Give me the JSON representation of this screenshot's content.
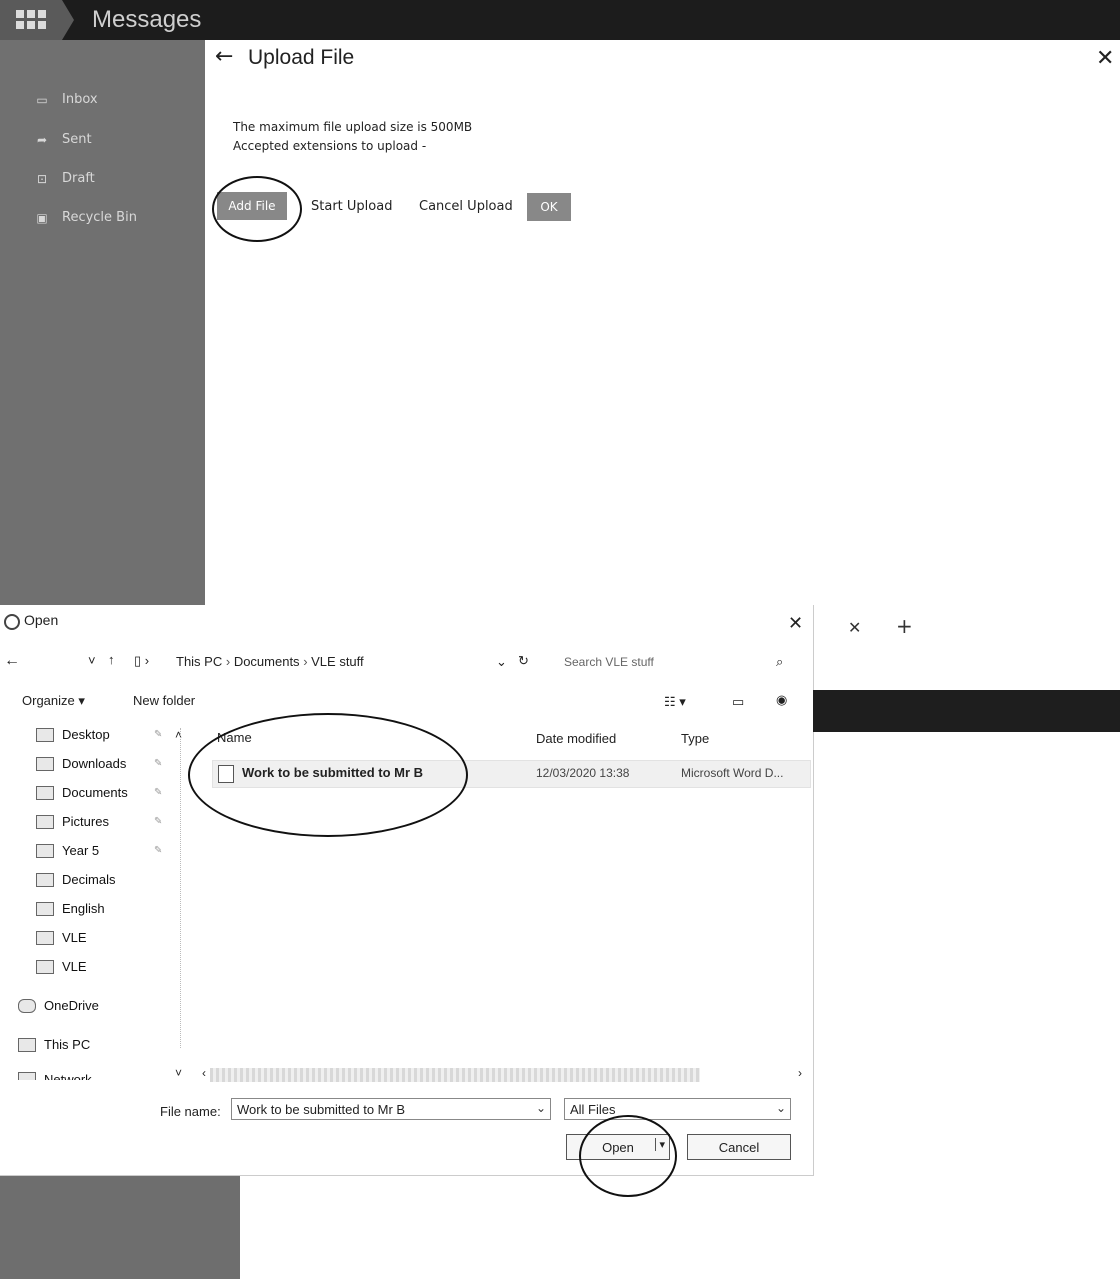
{
  "app": {
    "title": "Messages"
  },
  "sidebar": {
    "items": [
      {
        "label": "Inbox",
        "icon": "inbox-icon"
      },
      {
        "label": "Sent",
        "icon": "sent-arrow-icon"
      },
      {
        "label": "Draft",
        "icon": "draft-icon"
      },
      {
        "label": "Recycle Bin",
        "icon": "trash-icon"
      }
    ]
  },
  "upload": {
    "title": "Upload File",
    "max_size_text": "The maximum file upload size is 500MB",
    "extensions_text": "Accepted extensions to upload -",
    "add_file_label": "Add File",
    "start_upload_label": "Start Upload",
    "cancel_upload_label": "Cancel Upload",
    "ok_label": "OK"
  },
  "dialog": {
    "title": "Open",
    "breadcrumb": [
      "This PC",
      "Documents",
      "VLE stuff"
    ],
    "search_placeholder": "Search VLE stuff",
    "organize_label": "Organize ▾",
    "new_folder_label": "New folder",
    "nav_items": [
      "Desktop",
      "Downloads",
      "Documents",
      "Pictures",
      "Year 5",
      "Decimals",
      "English",
      "VLE",
      "VLE"
    ],
    "onedrive_label": "OneDrive",
    "thispc_label": "This PC",
    "network_label": "Network",
    "columns": {
      "name": "Name",
      "date": "Date modified",
      "type": "Type"
    },
    "files": [
      {
        "name": "Work to be submitted to Mr B",
        "date": "12/03/2020 13:38",
        "type": "Microsoft Word D..."
      }
    ],
    "filename_label": "File name:",
    "filename_value": "Work to be submitted to Mr B",
    "filter_value": "All Files",
    "open_label": "Open",
    "cancel_label": "Cancel"
  }
}
